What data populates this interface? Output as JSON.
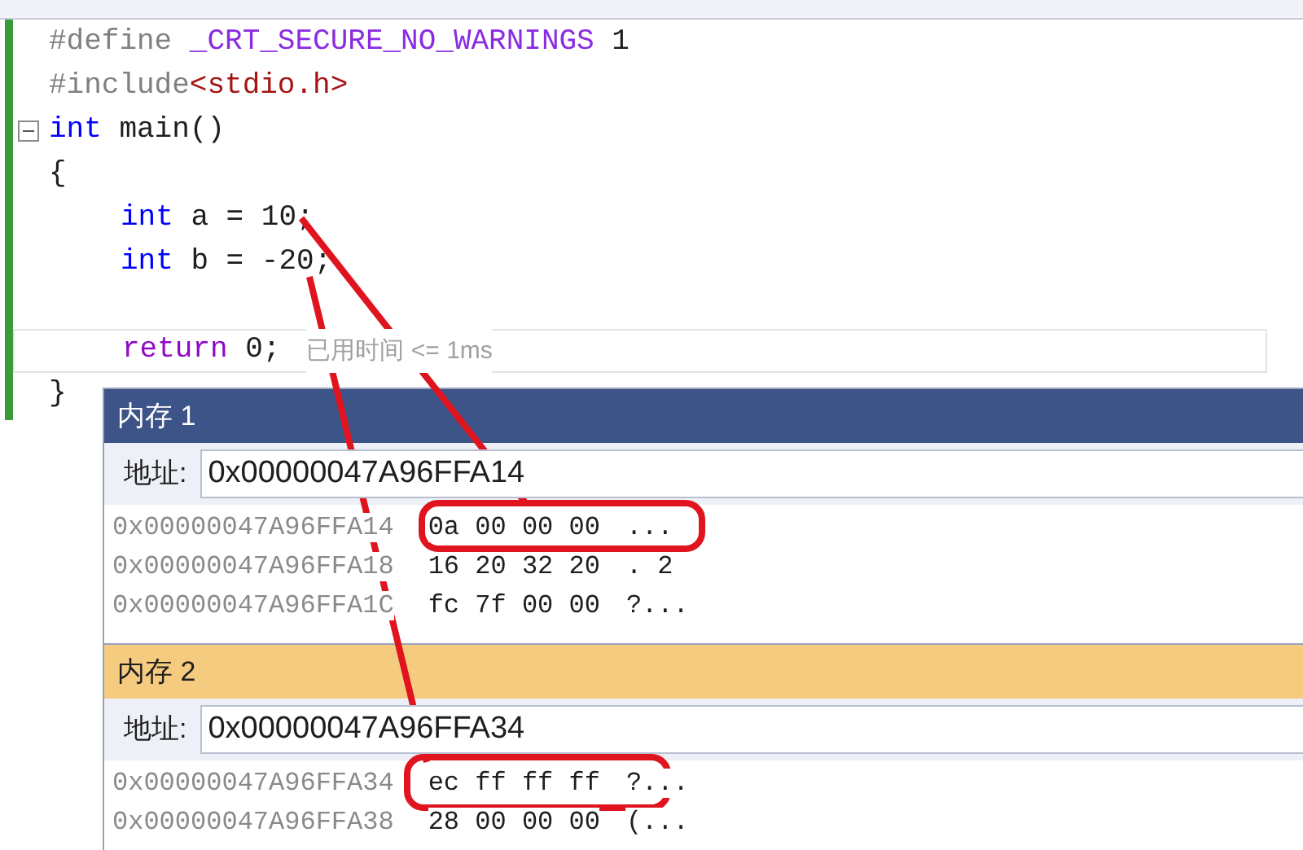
{
  "editor": {
    "lines": [
      {
        "indented": false,
        "current": false,
        "tokens": [
          {
            "kind": "preprocessor",
            "text": "#define"
          },
          {
            "kind": "macro",
            "text": "_CRT_SECURE_NO_WARNINGS"
          },
          {
            "kind": "plain",
            "text": " 1"
          }
        ]
      },
      {
        "indented": false,
        "current": false,
        "tokens": [
          {
            "kind": "preprocessor",
            "text": "#include"
          },
          {
            "kind": "string",
            "text": "<stdio.h>"
          }
        ]
      },
      {
        "indented": false,
        "current": false,
        "fold_expanded": true,
        "tokens": [
          {
            "kind": "keyword",
            "text": "int"
          },
          {
            "kind": "plain",
            "text": " main()"
          }
        ]
      },
      {
        "indented": false,
        "current": false,
        "tokens": [
          {
            "kind": "plain",
            "text": "{"
          }
        ]
      },
      {
        "indented": true,
        "current": false,
        "tokens": [
          {
            "kind": "keyword",
            "text": "int"
          },
          {
            "kind": "plain",
            "text": " a = 10;"
          }
        ]
      },
      {
        "indented": true,
        "current": false,
        "tokens": [
          {
            "kind": "keyword",
            "text": "int"
          },
          {
            "kind": "plain",
            "text": " b = -20;"
          }
        ]
      },
      {
        "kind": "blank"
      },
      {
        "indented": true,
        "current": true,
        "tokens": [
          {
            "kind": "control",
            "text": "return"
          },
          {
            "kind": "plain",
            "text": " 0;"
          },
          {
            "kind": "hint",
            "text": "已用时间 <= 1ms"
          }
        ]
      },
      {
        "indented": false,
        "current": false,
        "tokens": [
          {
            "kind": "plain",
            "text": "}"
          }
        ]
      }
    ]
  },
  "memory_windows": [
    {
      "title": "内存 1",
      "active": false,
      "address_label": "地址:",
      "address": "0x00000047A96FFA14",
      "rows": [
        {
          "address": "0x00000047A96FFA14",
          "bytes": "0a 00 00 00",
          "ascii": "..."
        },
        {
          "address": "0x00000047A96FFA18",
          "bytes": "16 20 32 20",
          "ascii": ". 2"
        },
        {
          "address": "0x00000047A96FFA1C",
          "bytes": "fc 7f 00 00",
          "ascii": "?..."
        }
      ]
    },
    {
      "title": "内存 2",
      "active": true,
      "address_label": "地址:",
      "address": "0x00000047A96FFA34",
      "rows": [
        {
          "address": "0x00000047A96FFA34",
          "bytes": "ec ff ff ff",
          "ascii": "?..."
        },
        {
          "address": "0x00000047A96FFA38",
          "bytes": "28 00 00 00",
          "ascii": "(..."
        }
      ]
    }
  ]
}
